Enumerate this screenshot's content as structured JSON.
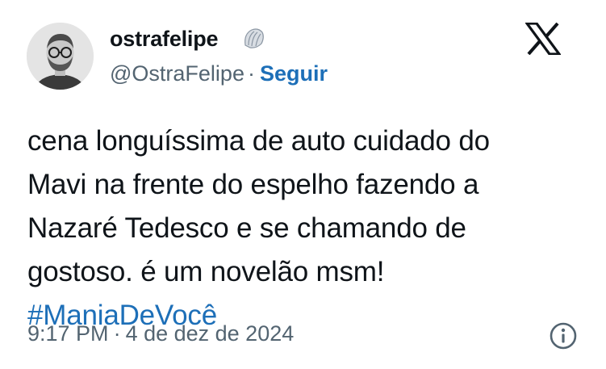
{
  "author": {
    "display_name": "ostrafelipe",
    "handle": "@OstraFelipe",
    "separator": "·",
    "follow_label": "Seguir",
    "badge_icon": "shell-badge-icon"
  },
  "brand": {
    "logo_icon": "x-logo-icon"
  },
  "tweet": {
    "lines": [
      "cena longuíssima de auto cuidado do",
      "Mavi na frente do espelho fazendo a",
      "Nazaré Tedesco e se chamando de",
      "gostoso. é um novelão msm!"
    ],
    "hashtag": "#ManiaDeVocê"
  },
  "meta": {
    "time": "9:17 PM",
    "separator": "·",
    "date": "4 de dez de 2024",
    "info_icon": "info-icon"
  },
  "colors": {
    "text": "#0f1419",
    "secondary": "#536471",
    "link": "#1d6fb8",
    "background": "#ffffff"
  }
}
